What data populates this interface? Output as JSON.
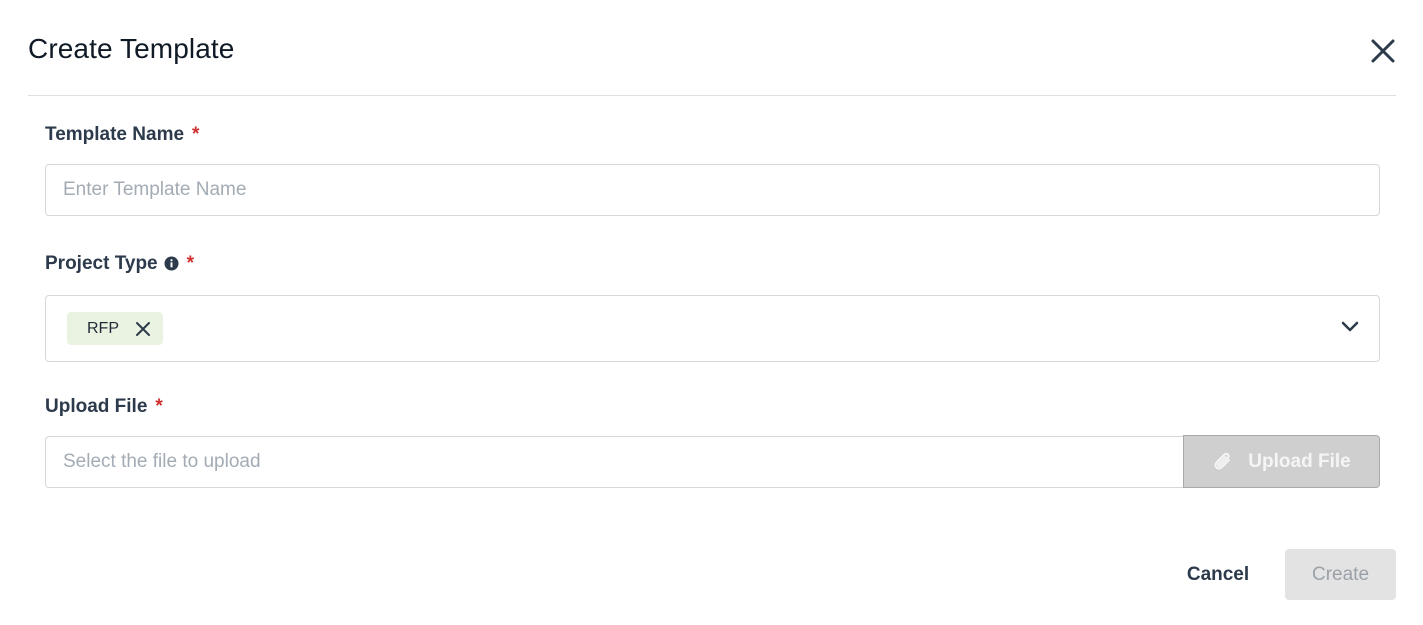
{
  "dialog": {
    "title": "Create Template",
    "close_icon": "close-icon"
  },
  "fields": {
    "template_name": {
      "label": "Template Name",
      "required_marker": "*",
      "value": "",
      "placeholder": "Enter Template Name"
    },
    "project_type": {
      "label": "Project Type",
      "info_icon": "info-icon",
      "required_marker": "*",
      "selected": [
        "RFP"
      ],
      "dropdown_icon": "chevron-down-icon"
    },
    "upload_file": {
      "label": "Upload File",
      "required_marker": "*",
      "value": "",
      "placeholder": "Select the file to upload",
      "button_label": "Upload File",
      "button_icon": "paperclip-icon"
    }
  },
  "footer": {
    "cancel_label": "Cancel",
    "create_label": "Create"
  },
  "colors": {
    "required": "#d0302f",
    "chip_bg": "#eaf3e2",
    "disabled_button_bg": "#e3e3e3",
    "upload_button_bg": "#cfcfcf"
  }
}
